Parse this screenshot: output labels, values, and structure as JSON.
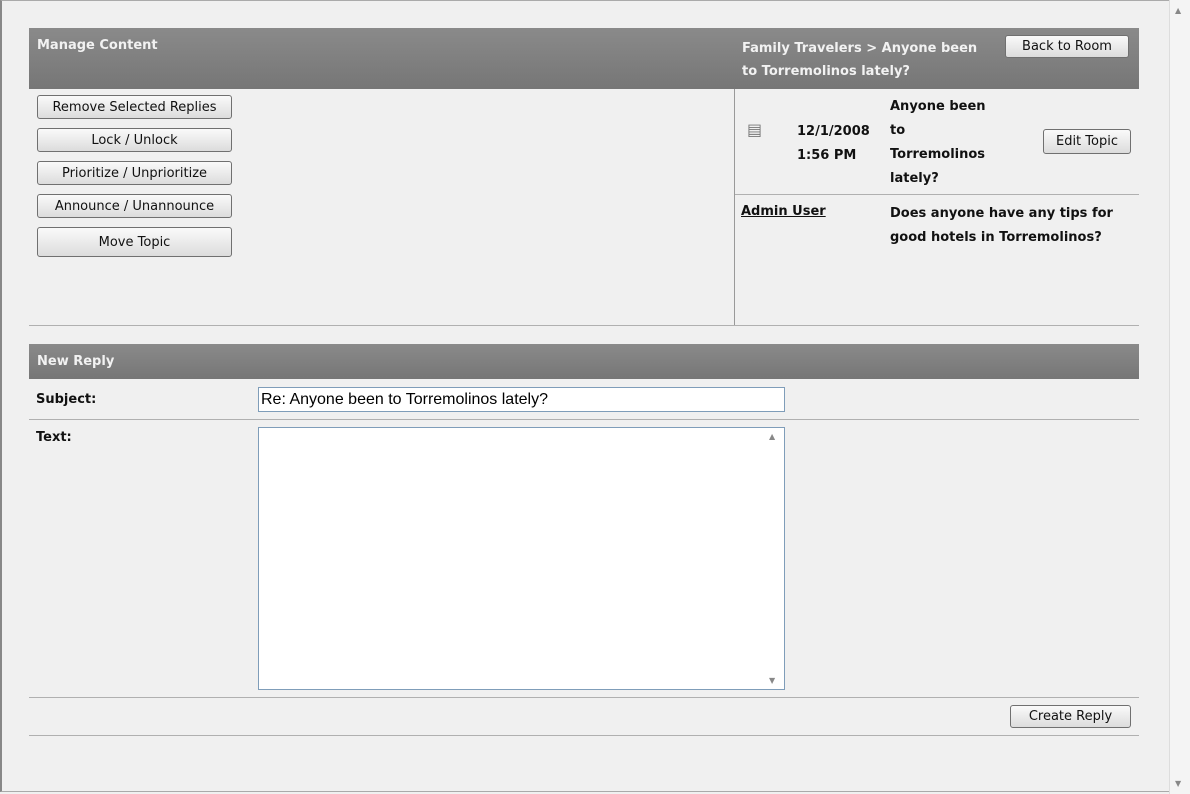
{
  "manage": {
    "title": "Manage Content",
    "buttons": [
      "Remove Selected Replies",
      "Lock / Unlock",
      "Prioritize / Unprioritize",
      "Announce / Unannounce",
      "Move Topic"
    ]
  },
  "breadcrumb": {
    "text": "Family Travelers > Anyone been to Torremolinos lately?",
    "back_label": "Back to Room"
  },
  "topic": {
    "icon": "notepad-icon",
    "date": "12/1/2008",
    "time": "1:56 PM",
    "title": "Anyone been to Torremolinos lately?",
    "edit_label": "Edit Topic",
    "author": "Admin User",
    "body": "Does anyone have any tips for good hotels in Torremolinos?"
  },
  "reply": {
    "title": "New Reply",
    "subject_label": "Subject:",
    "subject_value": "Re: Anyone been to Torremolinos lately?",
    "text_label": "Text:",
    "text_value": "",
    "create_label": "Create Reply"
  }
}
